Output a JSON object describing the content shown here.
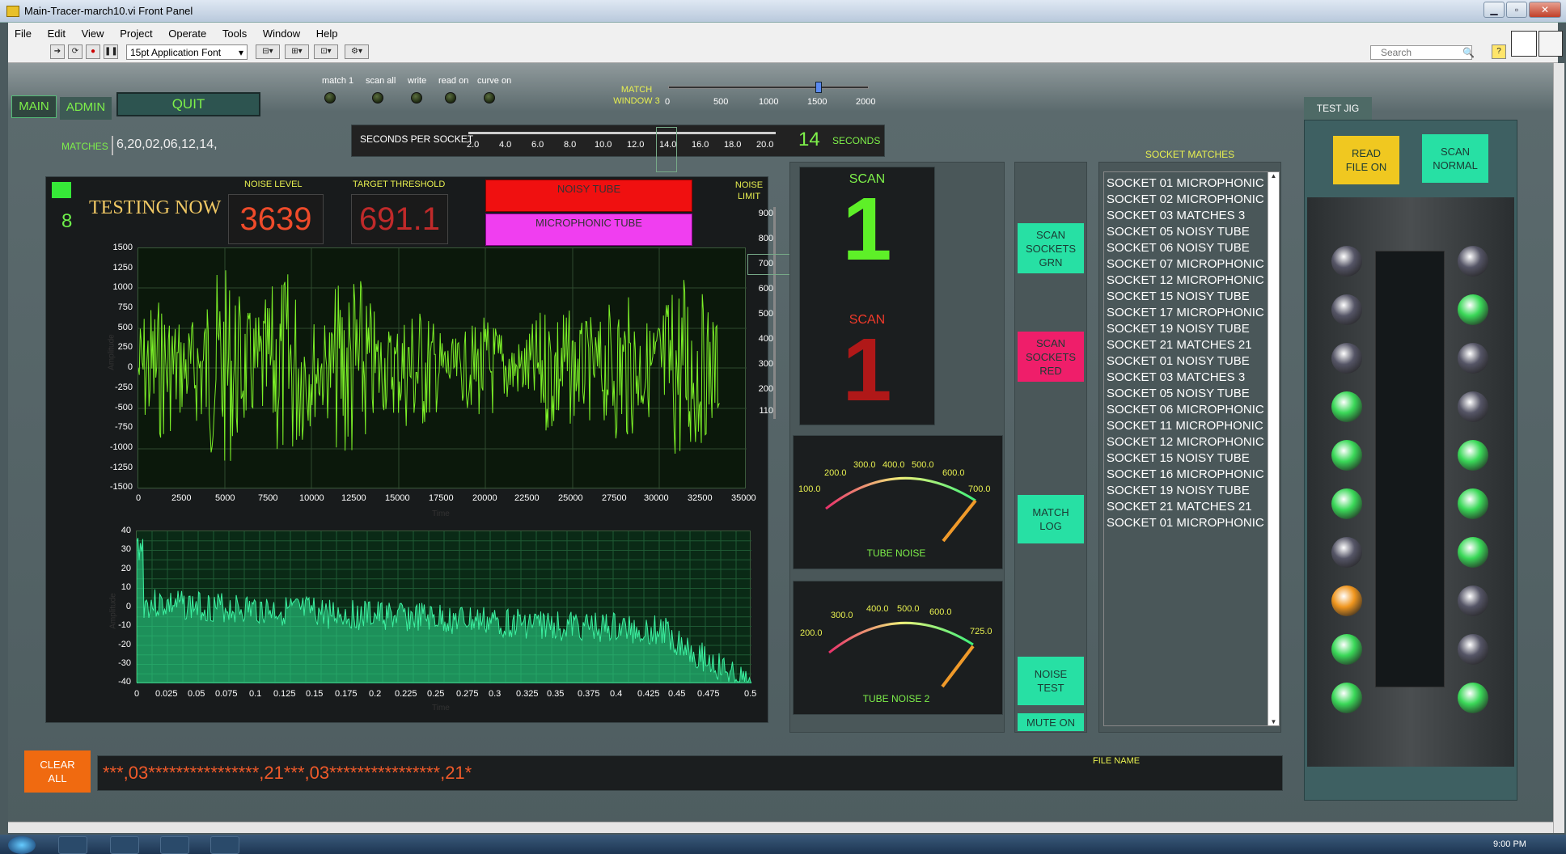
{
  "window": {
    "title": "Main-Tracer-march10.vi Front Panel"
  },
  "menu": [
    "File",
    "Edit",
    "View",
    "Project",
    "Operate",
    "Tools",
    "Window",
    "Help"
  ],
  "toolbar": {
    "font": "15pt Application Font",
    "search_placeholder": "Search",
    "help": "?"
  },
  "tabs": {
    "main": "MAIN",
    "admin": "ADMIN",
    "quit": "QUIT",
    "test_jig": "TEST JIG"
  },
  "leds": [
    "match 1",
    "scan all",
    "write",
    "read on",
    "curve on"
  ],
  "match_window": {
    "label": "MATCH WINDOW 3",
    "ticks": [
      "0",
      "500",
      "1000",
      "1500",
      "2000"
    ],
    "value": 1500
  },
  "matches": {
    "label": "MATCHES",
    "value": "6,20,02,06,12,14,"
  },
  "seconds": {
    "label": "SECONDS PER SOCKET",
    "ticks": [
      "2.0",
      "4.0",
      "6.0",
      "8.0",
      "10.0",
      "12.0",
      "14.0",
      "16.0",
      "18.0",
      "20.0"
    ],
    "value": "14",
    "unit": "SECONDS"
  },
  "status": {
    "count": "8",
    "text": "TESTING NOW",
    "noise_label": "NOISE LEVEL",
    "noise_value": "3639",
    "threshold_label": "TARGET THRESHOLD",
    "threshold_value": "691.1",
    "noisy": "NOISY TUBE",
    "microphonic": "MICROPHONIC TUBE",
    "noise_limit": "NOISE LIMIT"
  },
  "noise_limit_ticks": [
    "900",
    "800",
    "700",
    "600",
    "500",
    "400",
    "300",
    "200",
    "110"
  ],
  "plot1": {
    "y": [
      "1500",
      "1250",
      "1000",
      "750",
      "500",
      "250",
      "0",
      "-250",
      "-500",
      "-750",
      "-1000",
      "-1250",
      "-1500"
    ],
    "x": [
      "0",
      "2500",
      "5000",
      "7500",
      "10000",
      "12500",
      "15000",
      "17500",
      "20000",
      "22500",
      "25000",
      "27500",
      "30000",
      "32500",
      "35000"
    ],
    "xlabel": "Time",
    "ylabel": "Amplitude"
  },
  "plot2": {
    "y": [
      "40",
      "30",
      "20",
      "10",
      "0",
      "-10",
      "-20",
      "-30",
      "-40"
    ],
    "x": [
      "0",
      "0.025",
      "0.05",
      "0.075",
      "0.1",
      "0.125",
      "0.15",
      "0.175",
      "0.2",
      "0.225",
      "0.25",
      "0.275",
      "0.3",
      "0.325",
      "0.35",
      "0.375",
      "0.4",
      "0.425",
      "0.45",
      "0.475",
      "0.5"
    ],
    "xlabel": "Time",
    "ylabel": "Amplitude"
  },
  "scan": {
    "label1": "SCAN",
    "value1": "1",
    "label2": "SCAN",
    "value2": "1"
  },
  "gauge1": {
    "label": "TUBE NOISE",
    "ticks": [
      "100.0",
      "200.0",
      "300.0",
      "400.0",
      "500.0",
      "600.0",
      "700.0"
    ]
  },
  "gauge2": {
    "label": "TUBE NOISE 2",
    "ticks": [
      "200.0",
      "300.0",
      "400.0",
      "500.0",
      "600.0",
      "725.0"
    ]
  },
  "buttons": {
    "scan_grn": "SCAN SOCKETS GRN",
    "scan_red": "SCAN SOCKETS RED",
    "match_log": "MATCH LOG",
    "noise_test": "NOISE TEST",
    "mute": "MUTE ON",
    "read_file": "READ FILE ON",
    "scan_normal": "SCAN NORMAL",
    "clear_all": "CLEAR ALL"
  },
  "socket_matches": {
    "label": "SOCKET MATCHES",
    "items": [
      "SOCKET 01 MICROPHONIC",
      "SOCKET 02 MICROPHONIC",
      "SOCKET 03  MATCHES  3",
      "SOCKET 05 NOISY TUBE",
      "SOCKET 06 NOISY TUBE",
      "SOCKET 07 MICROPHONIC",
      "SOCKET 12 MICROPHONIC",
      "SOCKET 15 NOISY TUBE",
      "SOCKET 17 MICROPHONIC",
      "SOCKET 19 NOISY TUBE",
      "SOCKET 21  MATCHES  21",
      "SOCKET 01 NOISY TUBE",
      "SOCKET 03  MATCHES  3",
      "SOCKET 05 NOISY TUBE",
      "SOCKET 06 MICROPHONIC",
      "SOCKET 11 MICROPHONIC",
      "SOCKET 12 MICROPHONIC",
      "SOCKET 15 NOISY TUBE",
      "SOCKET 16 MICROPHONIC",
      "SOCKET 19 NOISY TUBE",
      "SOCKET 21  MATCHES  21",
      "SOCKET 01 MICROPHONIC"
    ]
  },
  "bottom": {
    "string": "***,03****************,21***,03****************,21*",
    "file_name": "FILE NAME"
  },
  "taskbar": {
    "time": "9:00 PM"
  },
  "colors": {
    "accent": "#6ef04a",
    "red": "#ef4b2a",
    "cyan": "#27e0a4"
  }
}
